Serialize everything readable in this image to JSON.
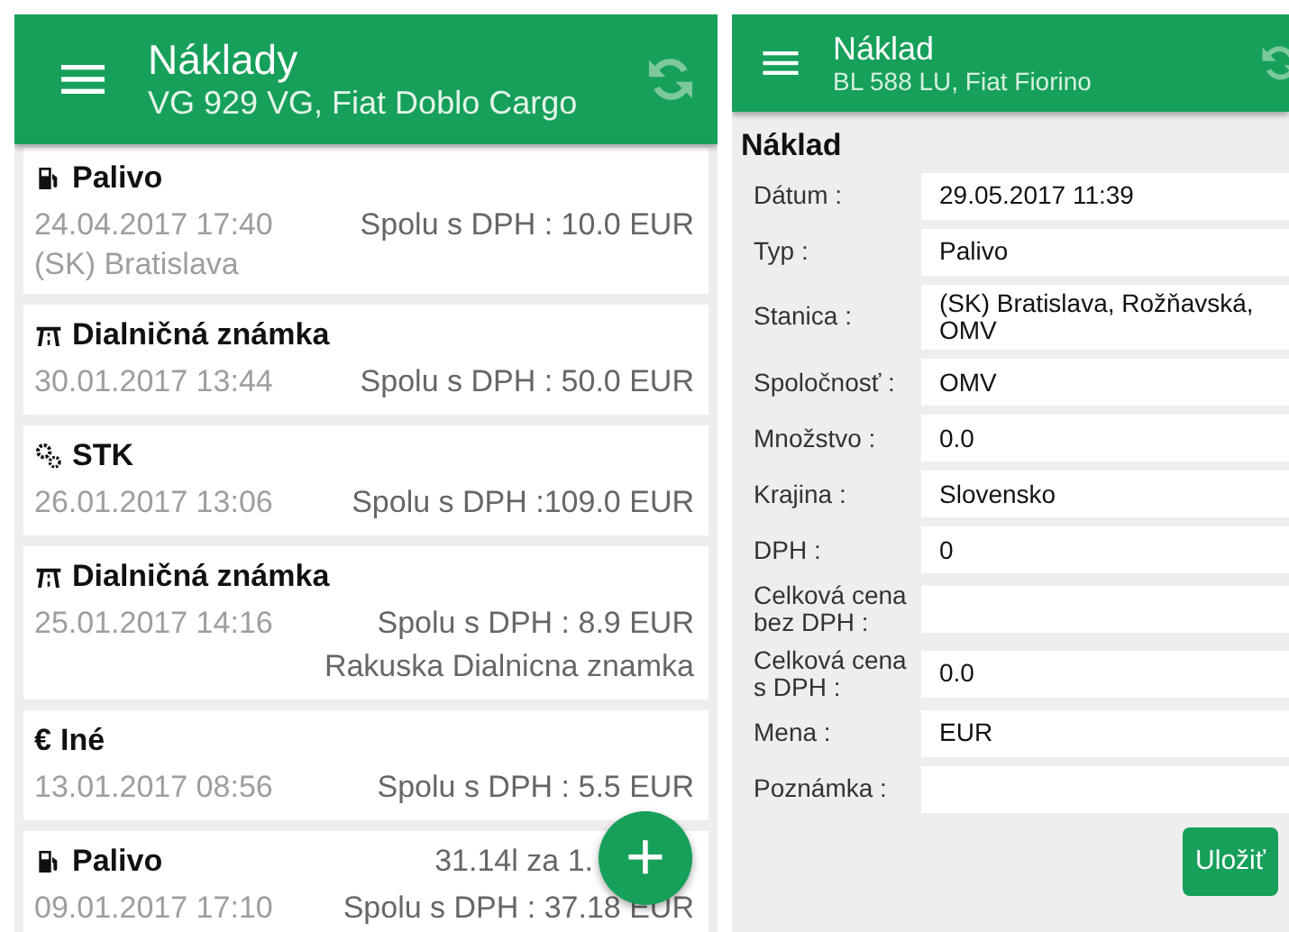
{
  "list_screen": {
    "title": "Náklady",
    "subtitle": "VG 929 VG, Fiat Doblo Cargo",
    "items": [
      {
        "kind": "fuel",
        "title": "Palivo",
        "date": "24.04.2017 17:40",
        "total": "Spolu s DPH : 10.0 EUR",
        "note": "(SK) Bratislava"
      },
      {
        "kind": "highway",
        "title": "Dialničná známka",
        "date": "30.01.2017 13:44",
        "total": "Spolu s DPH : 50.0 EUR"
      },
      {
        "kind": "service",
        "title": "STK",
        "date": "26.01.2017 13:06",
        "total": "Spolu s DPH :109.0 EUR"
      },
      {
        "kind": "highway",
        "title": "Dialničná známka",
        "date": "25.01.2017 14:16",
        "total": "Spolu s DPH : 8.9 EUR",
        "note_right": "Rakuska Dialnicna znamka"
      },
      {
        "kind": "other",
        "symbol": "€",
        "title": "Iné",
        "date": "13.01.2017 08:56",
        "total": "Spolu s DPH : 5.5 EUR"
      },
      {
        "kind": "fuel",
        "title": "Palivo",
        "amount": "31.14l za 1.",
        "date": "09.01.2017 17:10",
        "total": "Spolu s DPH : 37.18 EUR"
      }
    ],
    "fab": "+"
  },
  "detail_screen": {
    "title": "Náklad",
    "subtitle": "BL 588 LU, Fiat Fiorino",
    "heading": "Náklad",
    "fields": [
      {
        "label": "Dátum :",
        "value": "29.05.2017 11:39"
      },
      {
        "label": "Typ :",
        "value": "Palivo"
      },
      {
        "label": "Stanica :",
        "value": "(SK) Bratislava, Rožňavská, OMV"
      },
      {
        "label": "Spoločnosť :",
        "value": "OMV"
      },
      {
        "label": "Množstvo :",
        "value": "0.0"
      },
      {
        "label": "Krajina :",
        "value": "Slovensko"
      },
      {
        "label": "DPH :",
        "value": "0"
      },
      {
        "label": "Celková cena bez DPH :"
      },
      {
        "label": "Celková cena s DPH :",
        "value": "0.0"
      },
      {
        "label": "Mena :",
        "value": "EUR"
      },
      {
        "label": "Poznámka :"
      }
    ],
    "save_button": "Uložiť"
  }
}
